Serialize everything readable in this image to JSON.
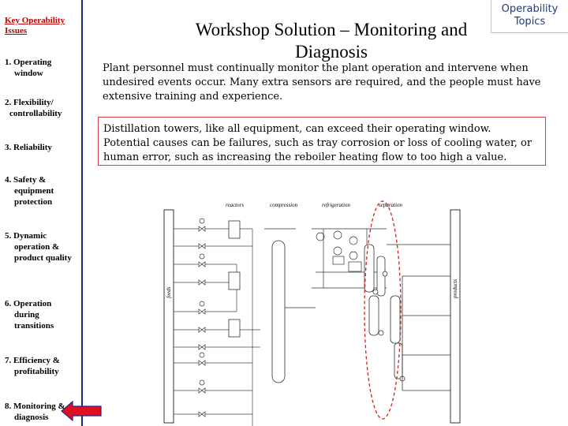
{
  "sidebar": {
    "header": "Key Operability Issues",
    "items": [
      {
        "line1": "1. Operating",
        "line2": "window"
      },
      {
        "line1": "2. Flexibility/",
        "line2": "controllability"
      },
      {
        "line1": "3. Reliability",
        "line2": ""
      },
      {
        "line1": "4. Safety &",
        "line2": "equipment protection"
      },
      {
        "line1": "5. Dynamic",
        "line2": "operation & product quality"
      },
      {
        "line1": "6. Operation",
        "line2": "during transitions"
      },
      {
        "line1": "7. Efficiency &",
        "line2": "profitability"
      },
      {
        "line1": "8. Monitoring &",
        "line2": "diagnosis"
      }
    ],
    "current_indicator": "left-arrow-icon",
    "accent_color": "#1f2a8a",
    "arrow_color": "#e01020"
  },
  "slide": {
    "title": "Workshop Solution – Monitoring and Diagnosis",
    "topic_badge": "Operability Topics",
    "paragraph1": "Plant personnel must continually monitor the plant operation and intervene when undesired events occur.  Many extra sensors are required, and the people must have extensive training and experience.",
    "paragraph2": "Distillation towers, like all equipment, can exceed their operating window. Potential causes can be failures, such as tray corrosion or loss of cooling water, or human error, such as increasing the reboiler heating flow to too high a value."
  },
  "diagram": {
    "section_labels": [
      "reactors",
      "compression",
      "refrigeration",
      "separation"
    ],
    "left_label": "feeds",
    "right_label": "products",
    "highlight_color": "#d02020"
  }
}
